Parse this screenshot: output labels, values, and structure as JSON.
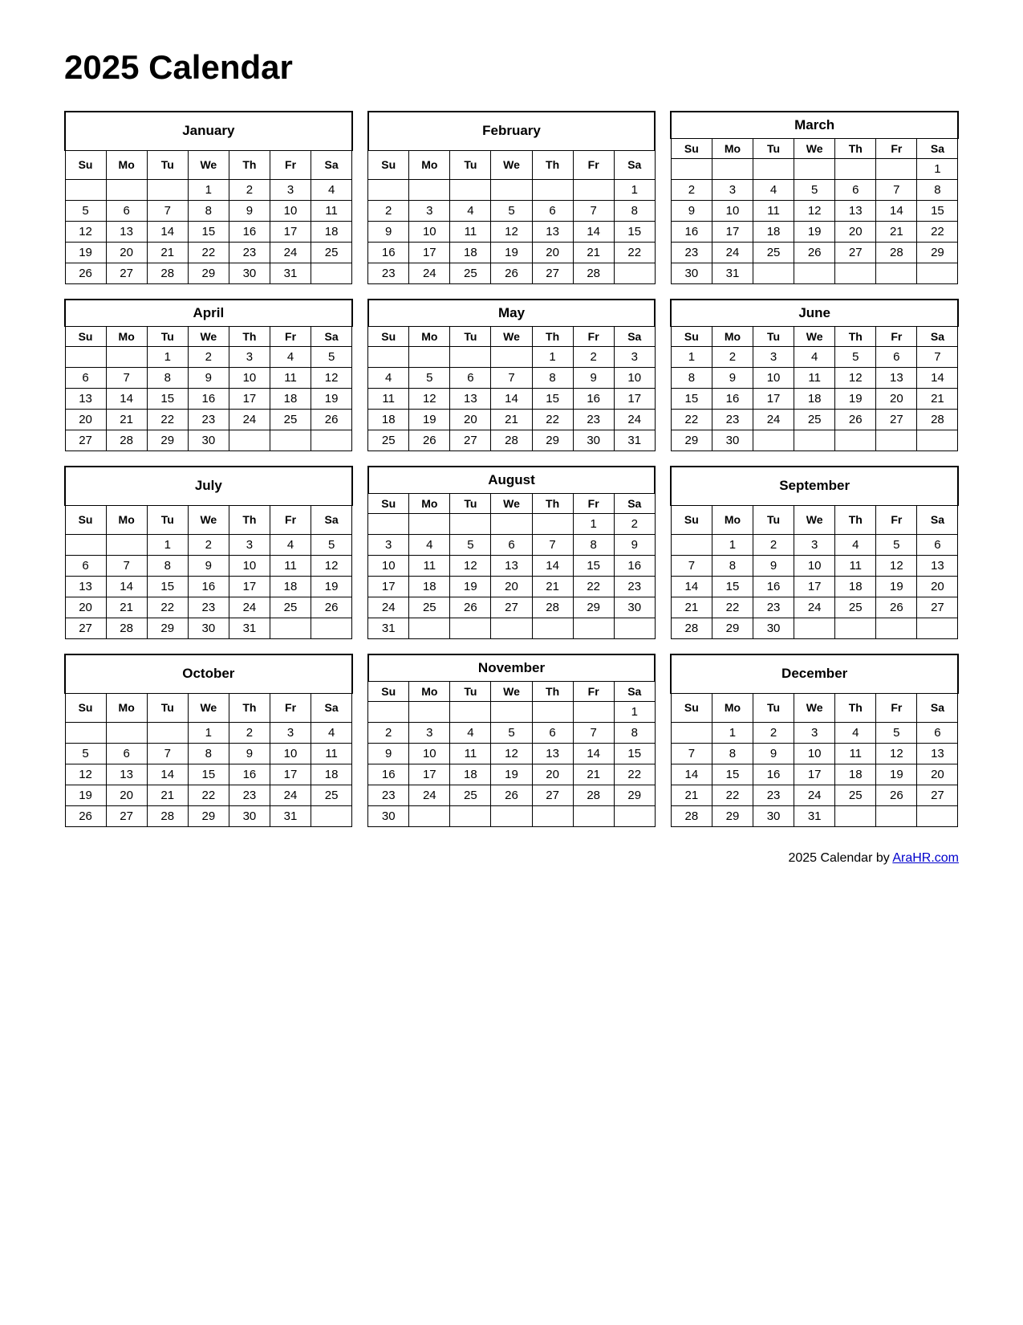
{
  "title": "2025 Calendar",
  "footer": {
    "text": "2025  Calendar by ",
    "link_label": "AraHR.com",
    "link_url": "AraHR.com"
  },
  "months": [
    {
      "name": "January",
      "rows": [
        [
          "",
          "",
          "",
          "1",
          "2",
          "3",
          "4"
        ],
        [
          "5",
          "6",
          "7",
          "8",
          "9",
          "10",
          "11"
        ],
        [
          "12",
          "13",
          "14",
          "15",
          "16",
          "17",
          "18"
        ],
        [
          "19",
          "20",
          "21",
          "22",
          "23",
          "24",
          "25"
        ],
        [
          "26",
          "27",
          "28",
          "29",
          "30",
          "31",
          ""
        ]
      ]
    },
    {
      "name": "February",
      "rows": [
        [
          "",
          "",
          "",
          "",
          "",
          "",
          "1"
        ],
        [
          "2",
          "3",
          "4",
          "5",
          "6",
          "7",
          "8"
        ],
        [
          "9",
          "10",
          "11",
          "12",
          "13",
          "14",
          "15"
        ],
        [
          "16",
          "17",
          "18",
          "19",
          "20",
          "21",
          "22"
        ],
        [
          "23",
          "24",
          "25",
          "26",
          "27",
          "28",
          ""
        ]
      ]
    },
    {
      "name": "March",
      "rows": [
        [
          "",
          "",
          "",
          "",
          "",
          "",
          "1"
        ],
        [
          "2",
          "3",
          "4",
          "5",
          "6",
          "7",
          "8"
        ],
        [
          "9",
          "10",
          "11",
          "12",
          "13",
          "14",
          "15"
        ],
        [
          "16",
          "17",
          "18",
          "19",
          "20",
          "21",
          "22"
        ],
        [
          "23",
          "24",
          "25",
          "26",
          "27",
          "28",
          "29"
        ],
        [
          "30",
          "31",
          "",
          "",
          "",
          "",
          ""
        ]
      ]
    },
    {
      "name": "April",
      "rows": [
        [
          "",
          "",
          "1",
          "2",
          "3",
          "4",
          "5"
        ],
        [
          "6",
          "7",
          "8",
          "9",
          "10",
          "11",
          "12"
        ],
        [
          "13",
          "14",
          "15",
          "16",
          "17",
          "18",
          "19"
        ],
        [
          "20",
          "21",
          "22",
          "23",
          "24",
          "25",
          "26"
        ],
        [
          "27",
          "28",
          "29",
          "30",
          "",
          "",
          ""
        ]
      ]
    },
    {
      "name": "May",
      "rows": [
        [
          "",
          "",
          "",
          "",
          "1",
          "2",
          "3"
        ],
        [
          "4",
          "5",
          "6",
          "7",
          "8",
          "9",
          "10"
        ],
        [
          "11",
          "12",
          "13",
          "14",
          "15",
          "16",
          "17"
        ],
        [
          "18",
          "19",
          "20",
          "21",
          "22",
          "23",
          "24"
        ],
        [
          "25",
          "26",
          "27",
          "28",
          "29",
          "30",
          "31"
        ]
      ]
    },
    {
      "name": "June",
      "rows": [
        [
          "1",
          "2",
          "3",
          "4",
          "5",
          "6",
          "7"
        ],
        [
          "8",
          "9",
          "10",
          "11",
          "12",
          "13",
          "14"
        ],
        [
          "15",
          "16",
          "17",
          "18",
          "19",
          "20",
          "21"
        ],
        [
          "22",
          "23",
          "24",
          "25",
          "26",
          "27",
          "28"
        ],
        [
          "29",
          "30",
          "",
          "",
          "",
          "",
          ""
        ]
      ]
    },
    {
      "name": "July",
      "rows": [
        [
          "",
          "",
          "1",
          "2",
          "3",
          "4",
          "5"
        ],
        [
          "6",
          "7",
          "8",
          "9",
          "10",
          "11",
          "12"
        ],
        [
          "13",
          "14",
          "15",
          "16",
          "17",
          "18",
          "19"
        ],
        [
          "20",
          "21",
          "22",
          "23",
          "24",
          "25",
          "26"
        ],
        [
          "27",
          "28",
          "29",
          "30",
          "31",
          "",
          ""
        ]
      ]
    },
    {
      "name": "August",
      "rows": [
        [
          "",
          "",
          "",
          "",
          "",
          "1",
          "2"
        ],
        [
          "3",
          "4",
          "5",
          "6",
          "7",
          "8",
          "9"
        ],
        [
          "10",
          "11",
          "12",
          "13",
          "14",
          "15",
          "16"
        ],
        [
          "17",
          "18",
          "19",
          "20",
          "21",
          "22",
          "23"
        ],
        [
          "24",
          "25",
          "26",
          "27",
          "28",
          "29",
          "30"
        ],
        [
          "31",
          "",
          "",
          "",
          "",
          "",
          ""
        ]
      ]
    },
    {
      "name": "September",
      "rows": [
        [
          "",
          "1",
          "2",
          "3",
          "4",
          "5",
          "6"
        ],
        [
          "7",
          "8",
          "9",
          "10",
          "11",
          "12",
          "13"
        ],
        [
          "14",
          "15",
          "16",
          "17",
          "18",
          "19",
          "20"
        ],
        [
          "21",
          "22",
          "23",
          "24",
          "25",
          "26",
          "27"
        ],
        [
          "28",
          "29",
          "30",
          "",
          "",
          "",
          ""
        ]
      ]
    },
    {
      "name": "October",
      "rows": [
        [
          "",
          "",
          "",
          "1",
          "2",
          "3",
          "4"
        ],
        [
          "5",
          "6",
          "7",
          "8",
          "9",
          "10",
          "11"
        ],
        [
          "12",
          "13",
          "14",
          "15",
          "16",
          "17",
          "18"
        ],
        [
          "19",
          "20",
          "21",
          "22",
          "23",
          "24",
          "25"
        ],
        [
          "26",
          "27",
          "28",
          "29",
          "30",
          "31",
          ""
        ]
      ]
    },
    {
      "name": "November",
      "rows": [
        [
          "",
          "",
          "",
          "",
          "",
          "",
          "1"
        ],
        [
          "2",
          "3",
          "4",
          "5",
          "6",
          "7",
          "8"
        ],
        [
          "9",
          "10",
          "11",
          "12",
          "13",
          "14",
          "15"
        ],
        [
          "16",
          "17",
          "18",
          "19",
          "20",
          "21",
          "22"
        ],
        [
          "23",
          "24",
          "25",
          "26",
          "27",
          "28",
          "29"
        ],
        [
          "30",
          "",
          "",
          "",
          "",
          "",
          ""
        ]
      ]
    },
    {
      "name": "December",
      "rows": [
        [
          "",
          "1",
          "2",
          "3",
          "4",
          "5",
          "6"
        ],
        [
          "7",
          "8",
          "9",
          "10",
          "11",
          "12",
          "13"
        ],
        [
          "14",
          "15",
          "16",
          "17",
          "18",
          "19",
          "20"
        ],
        [
          "21",
          "22",
          "23",
          "24",
          "25",
          "26",
          "27"
        ],
        [
          "28",
          "29",
          "30",
          "31",
          "",
          "",
          ""
        ]
      ]
    }
  ],
  "day_headers": [
    "Su",
    "Mo",
    "Tu",
    "We",
    "Th",
    "Fr",
    "Sa"
  ]
}
